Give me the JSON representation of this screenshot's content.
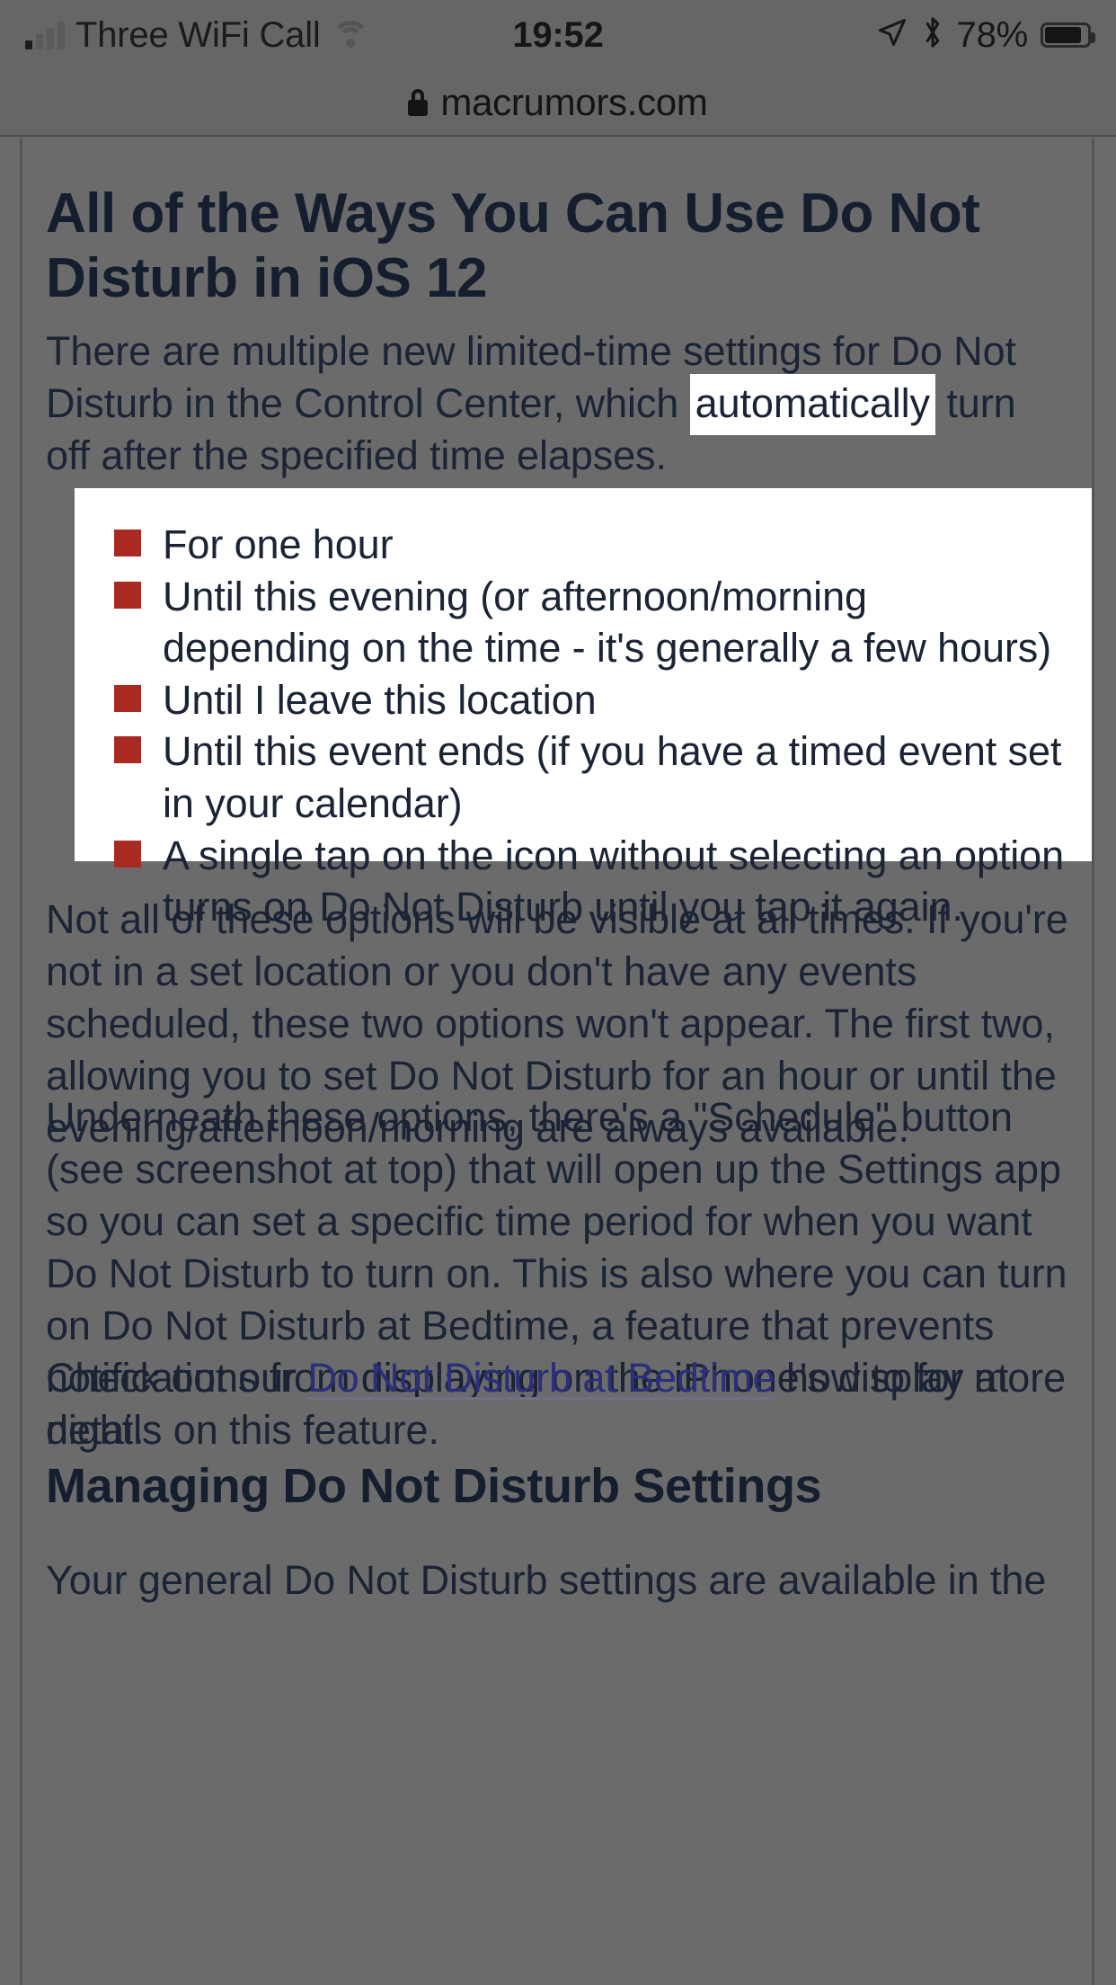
{
  "status_bar": {
    "carrier": "Three WiFi Call",
    "time": "19:52",
    "battery_percent": "78%",
    "signal_icon": "signal-bars-icon",
    "wifi_icon": "wifi-icon",
    "location_icon": "location-arrow-icon",
    "bluetooth_icon": "bluetooth-icon",
    "bluetooth_glyph": "ᛗ",
    "location_glyph": "➤",
    "battery_icon": "battery-icon"
  },
  "browser": {
    "lock_icon": "lock-icon",
    "url": "macrumors.com"
  },
  "article": {
    "title": "All of the Ways You Can Use Do Not Disturb in iOS 12",
    "intro_before": "There are multiple new limited-time settings for Do Not Disturb in the Control Center, which ",
    "intro_highlight": "automatically",
    "intro_after": " turn off after the specified time elapses.",
    "list_items": [
      "For one hour",
      "Until this evening (or afternoon/morning depending on the time - it's generally a few hours)",
      "Until I leave this location",
      "Until this event ends (if you have a timed event set in your calendar)",
      "A single tap on the icon without selecting an option turns on Do Not Disturb until you tap it again."
    ],
    "paragraph_2": "Not all of these options will be visible at all times. If you're not in a set location or you don't have any events scheduled, these two options won't appear. The first two, allowing you to set Do Not Disturb for an hour or until the evening/afternoon/morning are always available.",
    "paragraph_3": "Underneath these options, there's a \"Schedule\" button (see screenshot at top) that will open up the Settings app so you can set a specific time period for when you want Do Not Disturb to turn on. This is also where you can turn on Do Not Disturb at Bedtime, a feature that prevents notifications from displaying on the iPhone's display at night.",
    "paragraph_4_before": "Check out our ",
    "paragraph_4_link": "Do Not Disturb at Bedtime",
    "paragraph_4_after": " how to for more details on this feature.",
    "heading_2": "Managing Do Not Disturb Settings",
    "paragraph_5": "Your general Do Not Disturb settings are available in the"
  },
  "colors": {
    "overlay_background": "#6b6b6b",
    "text": "#1b2435",
    "heading": "#141e2e",
    "bullet_red": "#a92a23",
    "link": "#2b2f7a",
    "highlight_background": "#ffffff"
  }
}
